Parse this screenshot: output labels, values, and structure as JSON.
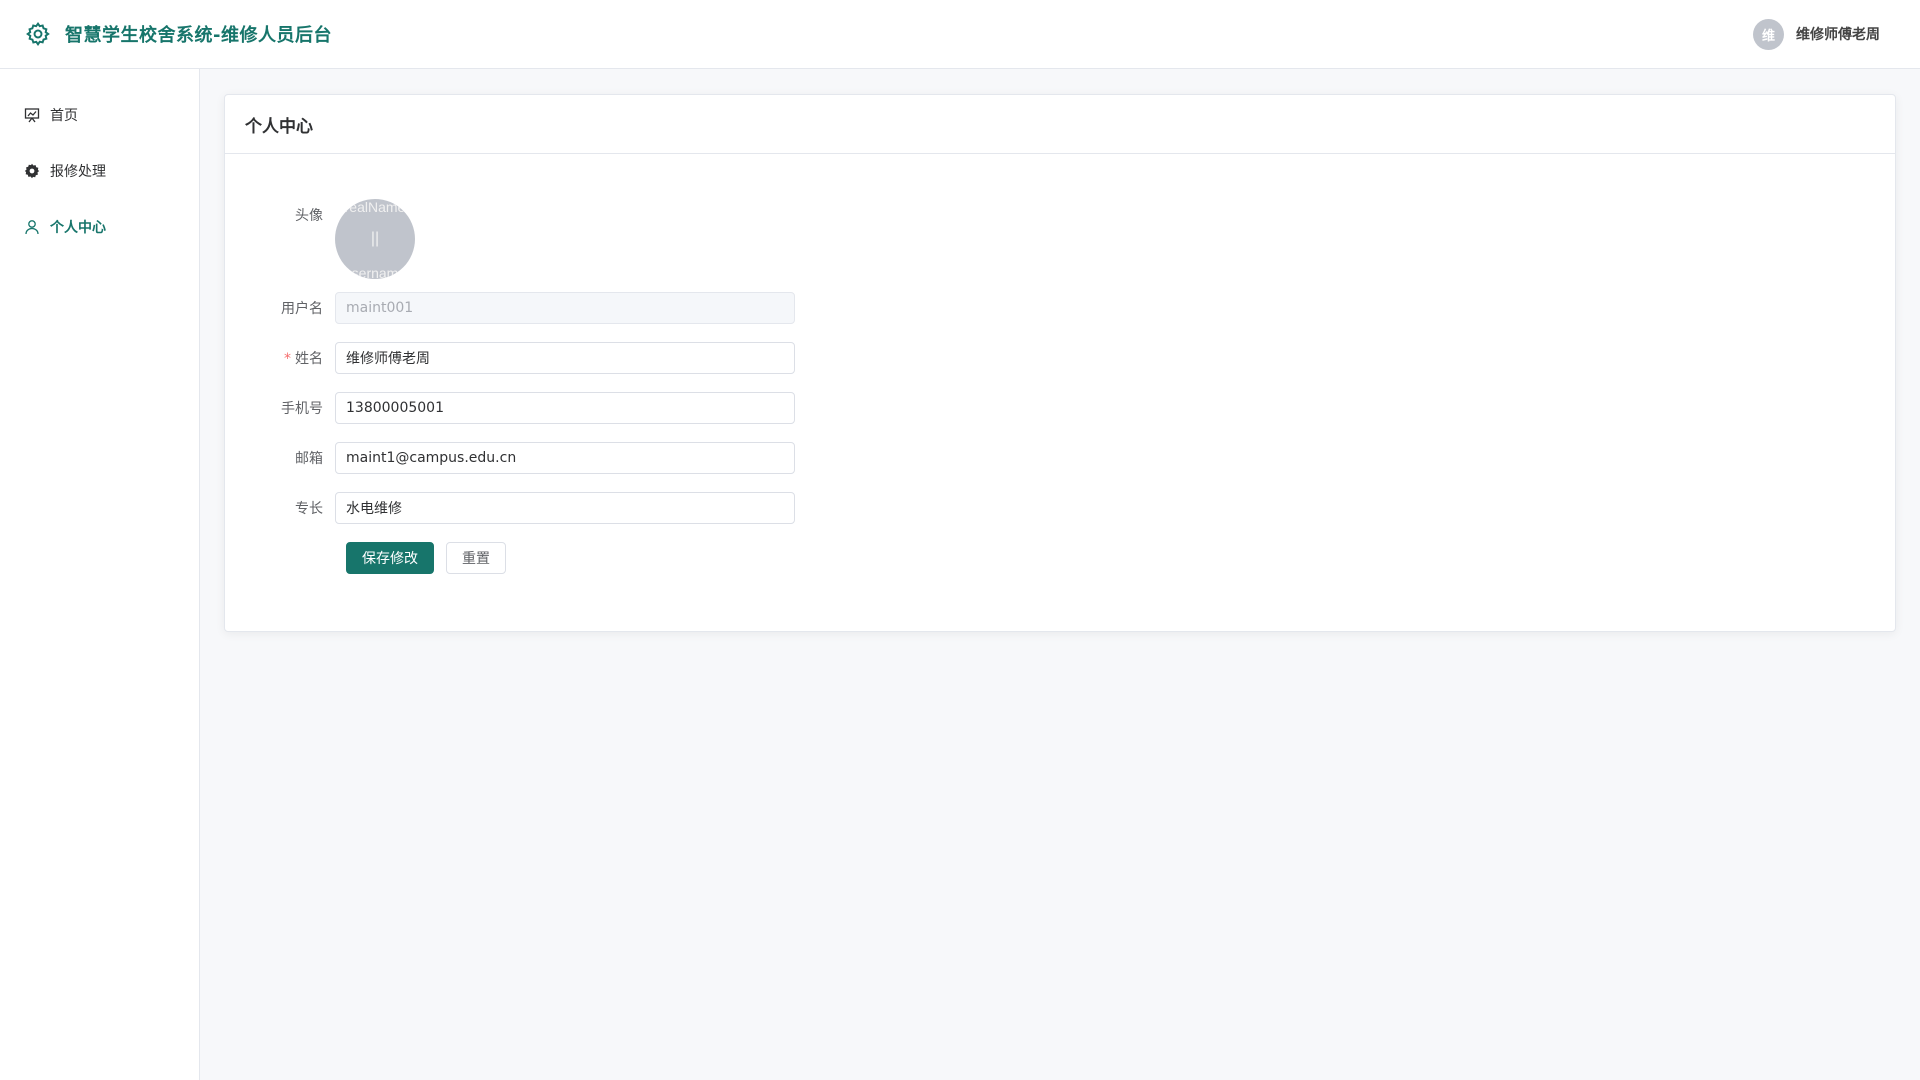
{
  "header": {
    "title": "智慧学生校舍系统-维修人员后台",
    "icon": "gear-icon",
    "user_avatar_text": "维",
    "user_name": "维修师傅老周"
  },
  "sidebar": {
    "items": [
      {
        "label": "首页",
        "icon": "dashboard-icon"
      },
      {
        "label": "报修处理",
        "icon": "settings-icon"
      },
      {
        "label": "个人中心",
        "icon": "user-icon",
        "active": true
      }
    ]
  },
  "profile": {
    "title": "个人中心",
    "avatar": {
      "label": "头像",
      "text_top": "realName",
      "text_mid": "||",
      "text_bottom": "username"
    },
    "username": {
      "label": "用户名",
      "value": "maint001"
    },
    "name": {
      "label": "姓名",
      "required_mark": "*",
      "value": "维修师傅老周"
    },
    "phone": {
      "label": "手机号",
      "value": "13800005001"
    },
    "email": {
      "label": "邮箱",
      "value": "maint1@campus.edu.cn"
    },
    "specialty": {
      "label": "专长",
      "value": "水电维修"
    },
    "save_label": "保存修改",
    "reset_label": "重置"
  },
  "colors": {
    "primary": "#17756b",
    "avatar_bg": "#c0c4cc",
    "required": "#f56c6c"
  }
}
